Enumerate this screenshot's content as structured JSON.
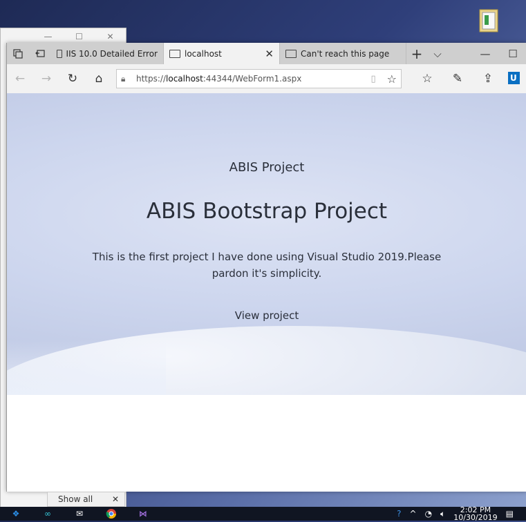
{
  "background_window": {
    "controls": [
      "—",
      "☐",
      "✕"
    ]
  },
  "browser": {
    "tabs": [
      {
        "label": "IIS 10.0 Detailed Error",
        "active": false
      },
      {
        "label": "localhost",
        "active": true
      },
      {
        "label": "Can't reach this page",
        "active": false
      }
    ],
    "new_tab": "+",
    "tab_list": "⌵",
    "minimize": "—",
    "maximize": "☐",
    "url_prefix": "https://",
    "url_host": "localhost",
    "url_rest": ":44344/WebForm1.aspx",
    "profile_initials": "U"
  },
  "page": {
    "subtitle": "ABIS Project",
    "heading": "ABIS Bootstrap Project",
    "description": "This is the first project I have done using Visual Studio 2019.Please pardon it's simplicity.",
    "link": "View project"
  },
  "downloads": {
    "show_all": "Show all",
    "close": "✕"
  },
  "taskbar": {
    "time": "2:02 PM",
    "date": "10/30/2019"
  },
  "colors": {
    "accent": "#0a6fc2",
    "taskbar": "#101522"
  }
}
